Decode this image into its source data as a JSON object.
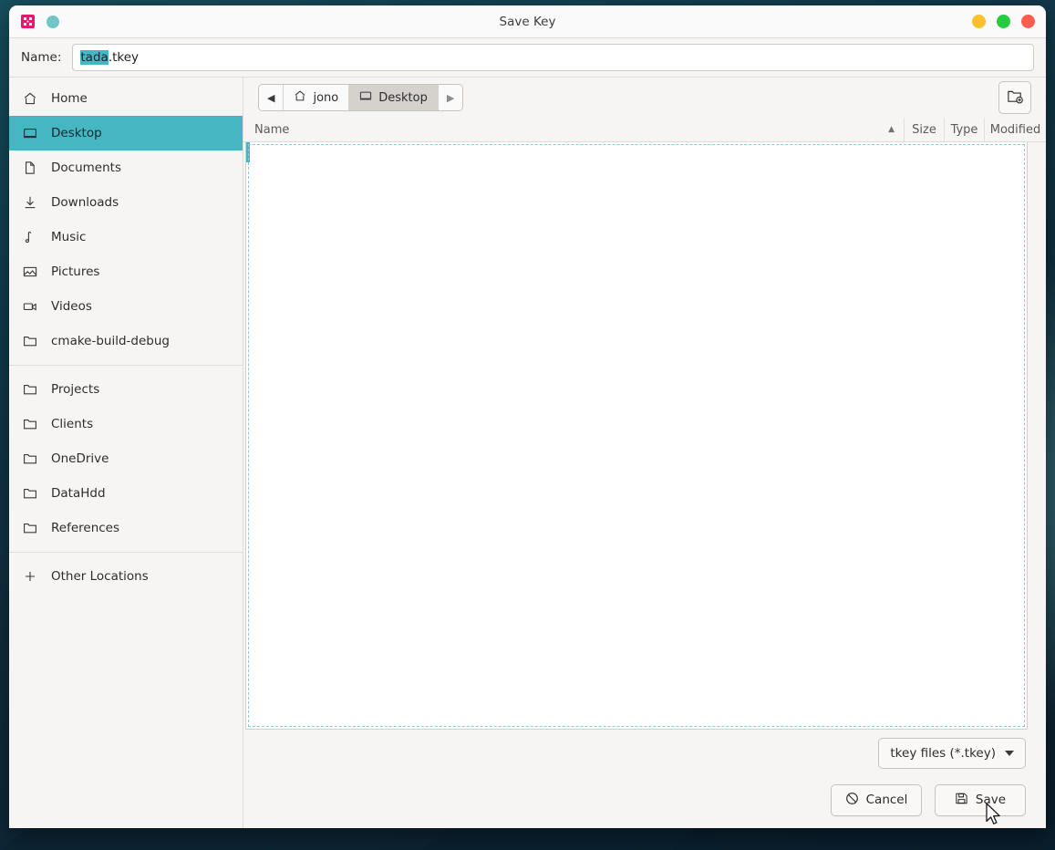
{
  "window": {
    "title": "Save Key",
    "app_icon": "app-logo-icon",
    "controls": [
      {
        "name": "minimize",
        "color": "#fcc02e"
      },
      {
        "name": "maximize",
        "color": "#27cc3e"
      },
      {
        "name": "close",
        "color": "#fb5e51"
      }
    ]
  },
  "name_field": {
    "label": "Name:",
    "value": "tada.tkey",
    "selected_text": "tada",
    "rest_text": ".tkey",
    "selection_color": "#46b6c3"
  },
  "sidebar": {
    "items": [
      {
        "label": "Home",
        "icon": "home-icon",
        "selected": false
      },
      {
        "label": "Desktop",
        "icon": "desktop-icon",
        "selected": true
      },
      {
        "label": "Documents",
        "icon": "document-icon",
        "selected": false
      },
      {
        "label": "Downloads",
        "icon": "download-icon",
        "selected": false
      },
      {
        "label": "Music",
        "icon": "music-note-icon",
        "selected": false
      },
      {
        "label": "Pictures",
        "icon": "image-icon",
        "selected": false
      },
      {
        "label": "Videos",
        "icon": "video-camera-icon",
        "selected": false
      },
      {
        "label": "cmake-build-debug",
        "icon": "folder-icon",
        "selected": false
      }
    ],
    "bookmarks": [
      {
        "label": "Projects",
        "icon": "folder-icon"
      },
      {
        "label": "Clients",
        "icon": "folder-icon"
      },
      {
        "label": "OneDrive",
        "icon": "folder-icon"
      },
      {
        "label": "DataHdd",
        "icon": "folder-icon"
      },
      {
        "label": "References",
        "icon": "folder-icon"
      }
    ],
    "other_locations": {
      "label": "Other Locations",
      "icon": "plus-icon"
    },
    "selected_color": "#46b6c3"
  },
  "pathbar": {
    "back_arrow": "◀",
    "forward_arrow": "▶",
    "crumbs": [
      {
        "label": "jono",
        "icon": "home-icon",
        "active": false
      },
      {
        "label": "Desktop",
        "icon": "desktop-icon",
        "active": true
      }
    ],
    "new_folder_button": "create-folder-icon"
  },
  "columns": {
    "name": "Name",
    "sort_indicator": "▲",
    "size": "Size",
    "type": "Type",
    "modified": "Modified"
  },
  "filelist": {
    "rows": []
  },
  "filter": {
    "label": "tkey files (*.tkey)"
  },
  "actions": {
    "cancel": {
      "label": "Cancel",
      "icon": "no-entry-icon"
    },
    "save": {
      "label": "Save",
      "icon": "floppy-disk-icon"
    }
  }
}
